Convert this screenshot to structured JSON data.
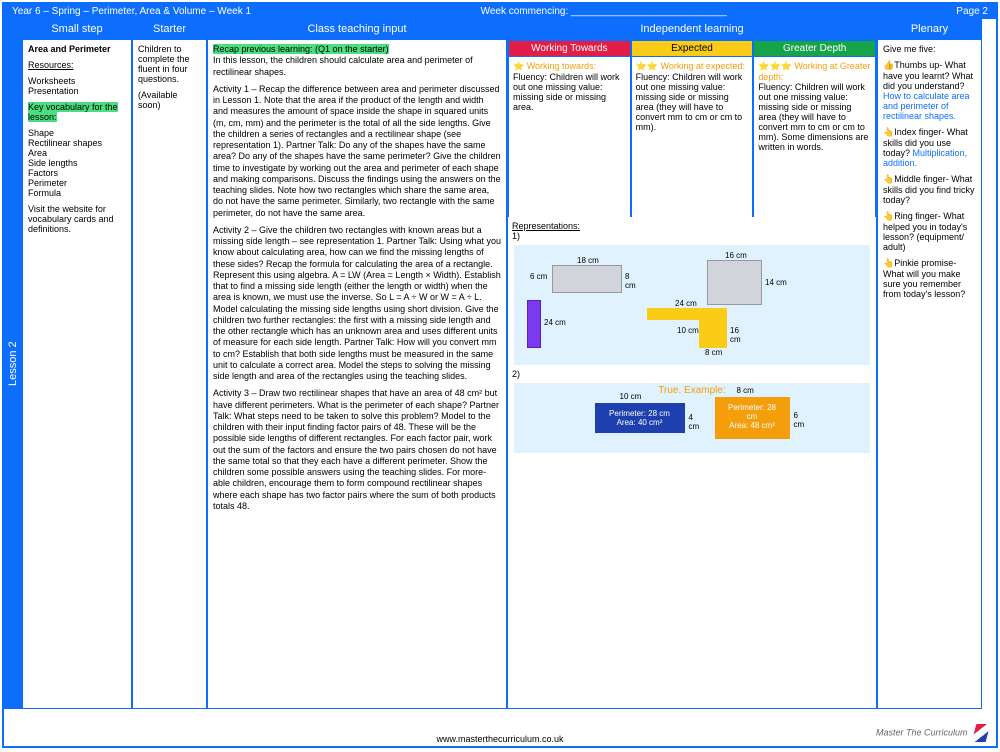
{
  "meta": {
    "title_left": "Year 6 – Spring – Perimeter, Area & Volume – Week 1",
    "title_mid": "Week commencing: ____________________________",
    "title_right": "Page 2"
  },
  "headers": {
    "small_step": "Small step",
    "starter": "Starter",
    "teaching": "Class teaching input",
    "independent": "Independent learning",
    "plenary": "Plenary"
  },
  "lesson_tab": "Lesson 2",
  "small_step": {
    "title": "Area and Perimeter",
    "resources_label": "Resources:",
    "resources": "Worksheets\nPresentation",
    "vocab_label": "Key vocabulary for the lesson:",
    "vocab": "Shape\nRectilinear shapes\nArea\nSide lengths\nFactors\nPerimeter\nFormula",
    "note": "Visit the website for vocabulary cards and definitions."
  },
  "starter": {
    "text": "Children to complete the fluent in four questions.",
    "note": "(Available soon)"
  },
  "teaching": {
    "recap": "Recap previous learning: (Q1 on the starter)",
    "intro": "In this lesson, the children should calculate area and perimeter of rectilinear shapes.",
    "activity1": "Activity 1 – Recap the difference between area and perimeter discussed in Lesson 1. Note that the area if the product of the length and width and measures the amount of space inside the shape in squared units (m, cm, mm) and the perimeter is the total of all the side lengths. Give the children a series of rectangles and a rectilinear shape (see representation 1). Partner Talk: Do any of the shapes have the same area? Do any of the shapes have the same perimeter? Give the children time to investigate by working out the area and perimeter of each shape and making comparisons. Discuss the findings using the answers on the teaching slides. Note how two rectangles which share the same area, do not have the same perimeter. Similarly, two rectangle with the same perimeter, do not have the same area.",
    "activity2": "Activity 2 – Give the children two rectangles with known areas but a missing side length – see representation 1. Partner Talk: Using what you know about calculating area, how can we find the missing lengths of these sides? Recap the formula for calculating the area of a rectangle. Represent this using algebra. A = LW (Area = Length × Width). Establish that to find a missing side length (either the length or width) when the area is known, we must use the inverse. So L = A ÷ W  or W = A ÷ L. Model calculating the missing side lengths using short division.  Give the children two further rectangles: the first with a missing side length and the other rectangle  which has an unknown area and uses different units of measure for each side length. Partner Talk: How will you convert mm to cm? Establish that both side lengths must be measured in the same unit to calculate a correct area. Model the steps to solving the missing side length and area of  the rectangles using the teaching slides.",
    "activity3": "Activity 3 – Draw two rectilinear shapes that have an area of 48 cm² but have different perimeters. What is the perimeter of each shape? Partner Talk: What steps need to be taken to solve this problem? Model to the children with their input finding factor pairs of 48. These will be the possible side lengths of different rectangles. For each factor pair, work out the sum of the factors and ensure the two pairs chosen do not have the same total so that they each have a different perimeter. Show the children some possible answers using the teaching slides. For more-able children, encourage them to form compound rectilinear shapes where each shape has two factor pairs where the sum of both products  totals 48."
  },
  "independent": {
    "wt": {
      "head": "Working Towards",
      "label": "⭐ Working towards:",
      "text": "Fluency: Children will work out one missing value: missing side or missing area."
    },
    "ex": {
      "head": "Expected",
      "label": "⭐⭐ Working at expected:",
      "text": "Fluency: Children will work out one missing value: missing side or missing area (they will have to convert mm to cm or cm to mm)."
    },
    "gd": {
      "head": "Greater Depth",
      "label": "⭐⭐⭐ Working at Greater depth:",
      "text": "Fluency: Children will work out one missing value: missing side or missing area (they will have to convert mm to cm or cm to mm). Some dimensions are written in words."
    },
    "rep_label": "Representations:",
    "rep1": {
      "dim1": "18 cm",
      "dim2": "6 cm",
      "dim3": "8 cm",
      "dim4": "16 cm",
      "dim5": "14 cm",
      "dim6": "24 cm",
      "dim7": "24 cm",
      "dim8": "10 cm",
      "dim9": "16 cm",
      "dim10": "8 cm"
    },
    "rep2": {
      "title": "True. Example:",
      "box1_top": "10 cm",
      "box1_side": "4 cm",
      "box1": "Perimeter: 28 cm\nArea: 40 cm²",
      "box2_top": "8 cm",
      "box2_side": "6 cm",
      "box2": "Perimeter: 28 cm\nArea: 48 cm²"
    }
  },
  "plenary": {
    "intro": "Give me five:",
    "thumb": "👍Thumbs up- What have you learnt? What did you understand?",
    "thumb_blue": "How to calculate area and perimeter of rectilinear shapes.",
    "index": "👆Index finger- What skills did you use today?",
    "index_blue": "Multiplication, addition.",
    "middle": "👆Middle finger- What skills did you find tricky today?",
    "ring": "👆Ring finger- What helped you in today's lesson? (equipment/ adult)",
    "pinkie": "👆Pinkie promise- What will you make sure you remember from today's lesson?"
  },
  "footer": "www.masterthecurriculum.co.uk",
  "logo_text": "Master The Curriculum"
}
